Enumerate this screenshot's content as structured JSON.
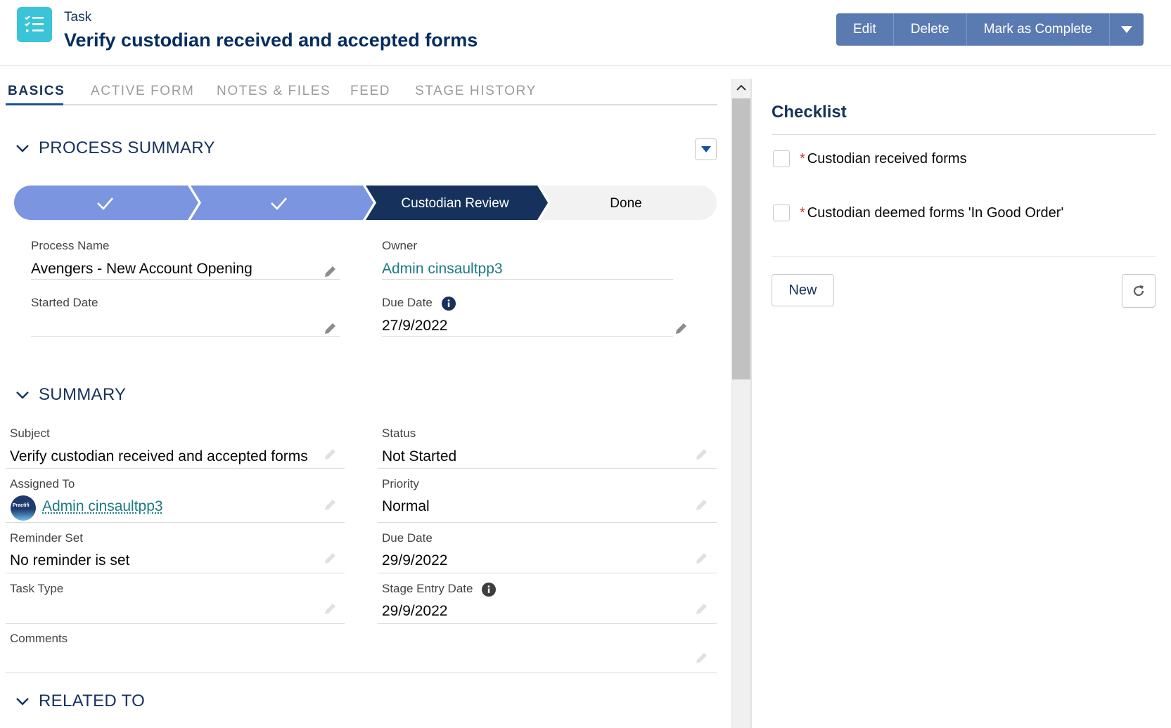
{
  "header": {
    "object_type": "Task",
    "title": "Verify custodian received and accepted forms",
    "buttons": {
      "edit": "Edit",
      "delete": "Delete",
      "complete": "Mark as Complete"
    }
  },
  "tabs": [
    "BASICS",
    "ACTIVE FORM",
    "NOTES & FILES",
    "FEED",
    "STAGE HISTORY"
  ],
  "active_tab": "BASICS",
  "process_summary": {
    "heading": "PROCESS SUMMARY",
    "path": {
      "steps": [
        "",
        "",
        "Custodian Review",
        "Done"
      ],
      "completed_steps": 2,
      "current_step": "Custodian Review"
    },
    "fields": {
      "process_name_label": "Process Name",
      "process_name_value": "Avengers - New Account Opening",
      "owner_label": "Owner",
      "owner_value": "Admin cinsaultpp3",
      "started_date_label": "Started Date",
      "started_date_value": "",
      "due_date_label": "Due Date",
      "due_date_value": "27/9/2022"
    }
  },
  "summary": {
    "heading": "SUMMARY",
    "subject_label": "Subject",
    "subject_value": "Verify custodian received and accepted forms",
    "status_label": "Status",
    "status_value": "Not Started",
    "assigned_label": "Assigned To",
    "assigned_value": "Admin cinsaultpp3",
    "avatar_text": "Practifi",
    "priority_label": "Priority",
    "priority_value": "Normal",
    "reminder_label": "Reminder Set",
    "reminder_value": "No reminder is set",
    "due_label": "Due Date",
    "due_value": "29/9/2022",
    "task_type_label": "Task Type",
    "task_type_value": "",
    "stage_entry_label": "Stage Entry Date",
    "stage_entry_value": "29/9/2022",
    "comments_label": "Comments",
    "comments_value": ""
  },
  "related": {
    "heading": "RELATED TO"
  },
  "checklist": {
    "title": "Checklist",
    "items": [
      {
        "label": "Custodian received forms",
        "required": true,
        "checked": false
      },
      {
        "label": "Custodian deemed forms 'In Good Order'",
        "required": true,
        "checked": false
      }
    ],
    "new_label": "New"
  },
  "colors": {
    "brand_dark": "#032d60",
    "button": "#5a7ab2",
    "path_complete": "#7b95e0",
    "path_current": "#16325c",
    "link": "#1c7a84",
    "task_icon": "#3bc4d8"
  },
  "icons": [
    "task-list-icon",
    "chevron-down-icon",
    "check-icon",
    "pencil-icon",
    "info-icon",
    "refresh-icon",
    "chevron-up-icon"
  ]
}
